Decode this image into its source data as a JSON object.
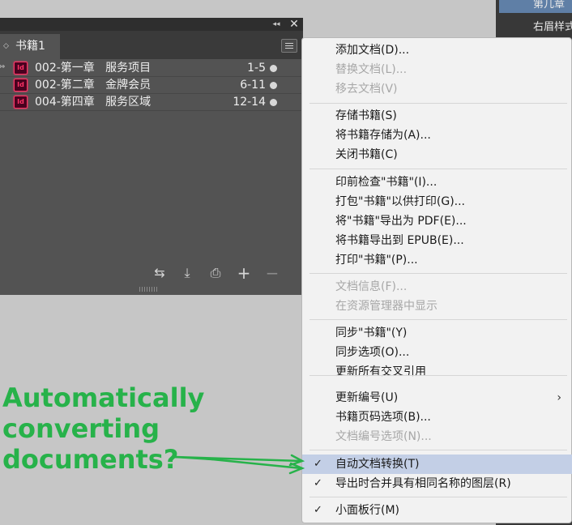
{
  "right_panel": {
    "items": [
      "第几章",
      "右眉样式"
    ]
  },
  "book_panel": {
    "tab_label": "书籍1",
    "tab_arrow": "◇",
    "collapse_glyph": "◂◂",
    "close_glyph": "✕",
    "documents": [
      {
        "name": "002-第一章   服务项目",
        "pages": "1-5",
        "sync_source": true
      },
      {
        "name": "002-第二章   金牌会员",
        "pages": "6-11",
        "sync_source": false
      },
      {
        "name": "004-第四章   服务区域",
        "pages": "12-14",
        "sync_source": false
      }
    ],
    "doc_icon_label": "Id",
    "toolbar_icons": [
      "sync-styles-icon",
      "save-book-icon",
      "print-book-icon",
      "add-document-icon",
      "remove-document-icon"
    ]
  },
  "flyout_menu": {
    "items": [
      {
        "label": "添加文档(D)...",
        "disabled": false
      },
      {
        "label": "替换文档(L)...",
        "disabled": true
      },
      {
        "label": "移去文档(V)",
        "disabled": true
      },
      {
        "label": "存储书籍(S)",
        "disabled": false
      },
      {
        "label": "将书籍存储为(A)...",
        "disabled": false
      },
      {
        "label": "关闭书籍(C)",
        "disabled": false
      },
      {
        "label": "印前检查\"书籍\"(I)...",
        "disabled": false
      },
      {
        "label": "打包\"书籍\"以供打印(G)...",
        "disabled": false
      },
      {
        "label": "将\"书籍\"导出为 PDF(E)...",
        "disabled": false
      },
      {
        "label": "将书籍导出到 EPUB(E)...",
        "disabled": false
      },
      {
        "label": "打印\"书籍\"(P)...",
        "disabled": false
      },
      {
        "label": "文档信息(F)...",
        "disabled": true
      },
      {
        "label": "在资源管理器中显示",
        "disabled": true
      },
      {
        "label": "同步\"书籍\"(Y)",
        "disabled": false
      },
      {
        "label": "同步选项(O)...",
        "disabled": false
      },
      {
        "label": "更新所有交叉引用",
        "disabled": false
      },
      {
        "label": "更新编号(U)",
        "disabled": false,
        "submenu": true
      },
      {
        "label": "书籍页码选项(B)...",
        "disabled": false
      },
      {
        "label": "文档编号选项(N)...",
        "disabled": true
      },
      {
        "label": "自动文档转换(T)",
        "disabled": false,
        "checked": true,
        "highlighted": true
      },
      {
        "label": "导出时合并具有相同名称的图层(R)",
        "disabled": false,
        "checked": true
      },
      {
        "label": "小面板行(M)",
        "disabled": false,
        "checked": true
      }
    ]
  },
  "annotation": {
    "line1": "Automatically",
    "line2": "converting documents?",
    "color": "#27b24a"
  }
}
